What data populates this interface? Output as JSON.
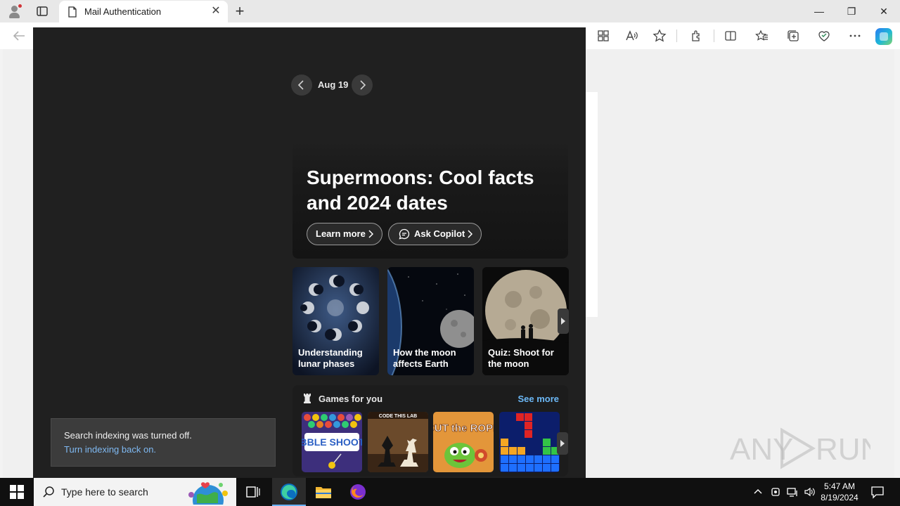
{
  "browser": {
    "tab_title": "Mail Authentication",
    "new_tab_glyph": "+",
    "close_tab_glyph": "✕",
    "window_controls": {
      "minimize": "—",
      "restore": "❐",
      "close": "✕"
    }
  },
  "flyout": {
    "date_label": "Aug 19",
    "hero": {
      "title": "Supermoons: Cool facts and 2024 dates",
      "learn_more": "Learn more",
      "ask_copilot": "Ask Copilot"
    },
    "cards": [
      {
        "label": "Understanding lunar phases"
      },
      {
        "label": "How the moon affects Earth"
      },
      {
        "label": "Quiz: Shoot for the moon"
      }
    ],
    "games": {
      "title": "Games for you",
      "see_more": "See more",
      "items": [
        {
          "name": "Bubble Shooter",
          "art_text": "BUBBLE SHOOTER"
        },
        {
          "name": "Master Chess",
          "art_text": "CODE THIS LAB"
        },
        {
          "name": "Cut The Rope",
          "art_text": "CUT the ROPE"
        },
        {
          "name": "Block Puzzle",
          "art_text": ""
        }
      ]
    },
    "toast": {
      "message": "Search indexing was turned off.",
      "link": "Turn indexing back on."
    }
  },
  "watermark": "ANY RUN",
  "taskbar": {
    "search_placeholder": "Type here to search",
    "time": "5:47 AM",
    "date": "8/19/2024"
  },
  "colors": {
    "flyout_bg": "#202020",
    "link_blue": "#6cb8f6",
    "taskbar": "#101010",
    "accent": "#0078d4"
  }
}
